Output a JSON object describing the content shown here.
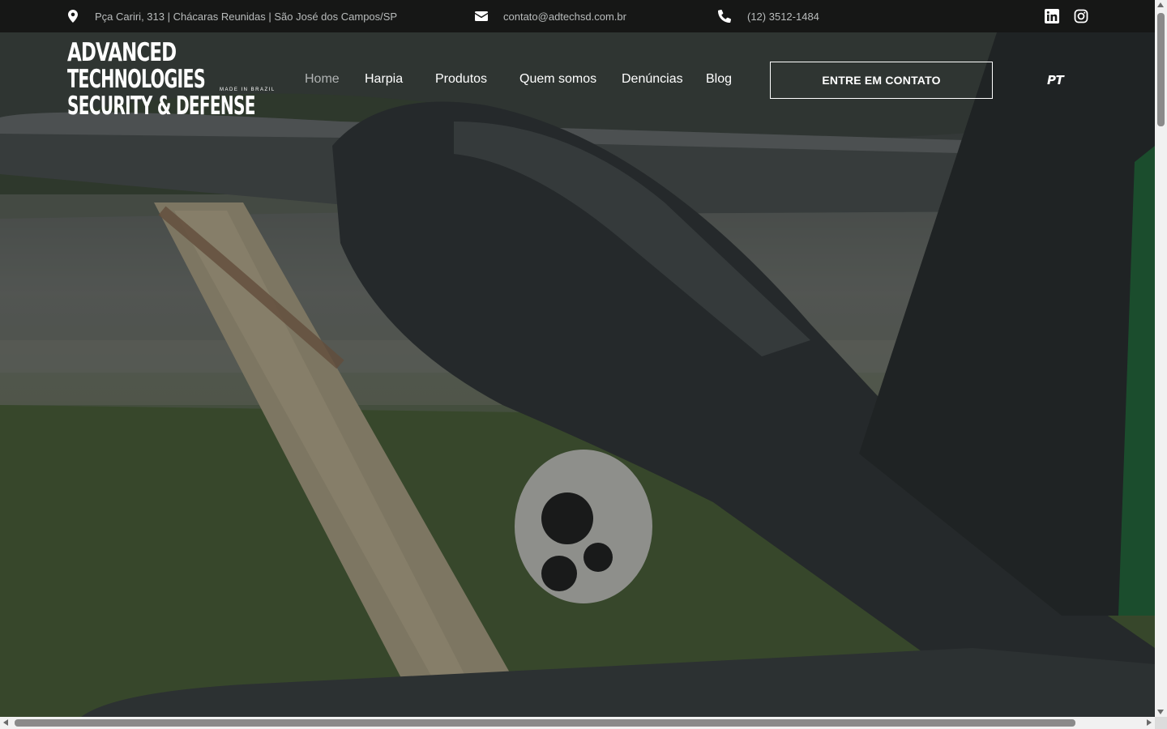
{
  "topbar": {
    "address": "Pça Cariri, 313 | Chácaras Reunidas | São José dos Campos/SP",
    "email": "contato@adtechsd.com.br",
    "phone": "(12) 3512-1484",
    "icons": {
      "address": "map-pin-icon",
      "email": "envelope-icon",
      "phone": "phone-icon",
      "linkedin": "linkedin-icon",
      "instagram": "instagram-icon"
    }
  },
  "header": {
    "logo": {
      "line1": "ADVANCED",
      "line2": "TECHNOLOGIES",
      "line3": "SECURITY & DEFENSE",
      "tagline": "MADE IN BRAZIL"
    },
    "nav": [
      {
        "label": "Home",
        "active": true
      },
      {
        "label": "Harpia",
        "active": false
      },
      {
        "label": "Produtos",
        "active": false
      },
      {
        "label": "Quem somos",
        "active": false
      },
      {
        "label": "Denúncias",
        "active": false
      },
      {
        "label": "Blog",
        "active": false
      }
    ],
    "cta_label": "ENTRE EM CONTATO",
    "language": "PT"
  },
  "colors": {
    "topbar_bg": "#161716",
    "topbar_text": "#b9bcbc",
    "nav_active": "#b0b3b3",
    "white": "#ffffff"
  }
}
